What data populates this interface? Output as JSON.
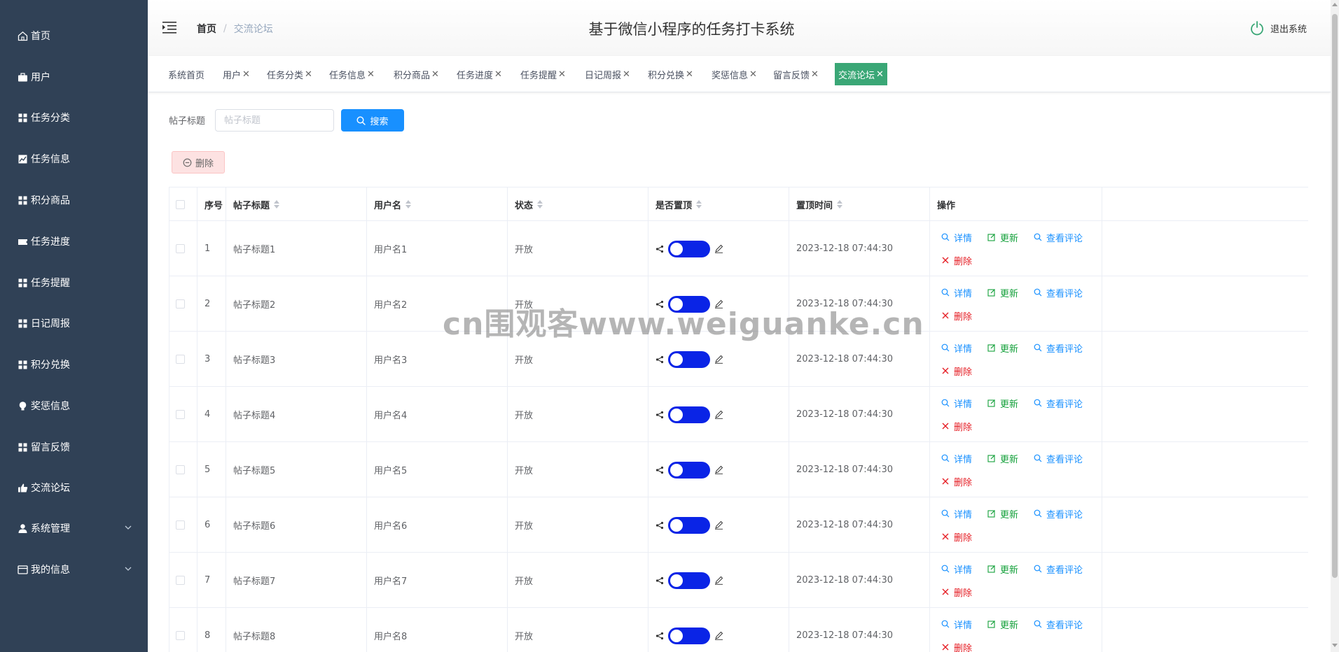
{
  "app": {
    "title": "基于微信小程序的任务打卡系统",
    "logout_label": "退出系统"
  },
  "breadcrumb": {
    "home": "首页",
    "separator": "/",
    "current": "交流论坛"
  },
  "sidebar": {
    "items": [
      {
        "label": "首页",
        "icon": "home-icon"
      },
      {
        "label": "用户",
        "icon": "briefcase-icon"
      },
      {
        "label": "任务分类",
        "icon": "grid-icon"
      },
      {
        "label": "任务信息",
        "icon": "chart-icon"
      },
      {
        "label": "积分商品",
        "icon": "grid-icon"
      },
      {
        "label": "任务进度",
        "icon": "ticket-icon"
      },
      {
        "label": "任务提醒",
        "icon": "grid-icon"
      },
      {
        "label": "日记周报",
        "icon": "grid-icon"
      },
      {
        "label": "积分兑换",
        "icon": "grid-icon"
      },
      {
        "label": "奖惩信息",
        "icon": "bulb-icon"
      },
      {
        "label": "留言反馈",
        "icon": "grid-icon"
      },
      {
        "label": "交流论坛",
        "icon": "thumb-icon"
      },
      {
        "label": "系统管理",
        "icon": "user-icon"
      },
      {
        "label": "我的信息",
        "icon": "card-icon"
      }
    ]
  },
  "tags": [
    {
      "label": "系统首页",
      "closable": false
    },
    {
      "label": "用户",
      "closable": true
    },
    {
      "label": "任务分类",
      "closable": true
    },
    {
      "label": "任务信息",
      "closable": true
    },
    {
      "label": "积分商品",
      "closable": true
    },
    {
      "label": "任务进度",
      "closable": true
    },
    {
      "label": "任务提醒",
      "closable": true
    },
    {
      "label": "日记周报",
      "closable": true
    },
    {
      "label": "积分兑换",
      "closable": true
    },
    {
      "label": "奖惩信息",
      "closable": true
    },
    {
      "label": "留言反馈",
      "closable": true
    },
    {
      "label": "交流论坛",
      "closable": true,
      "active": true
    }
  ],
  "tag_close_glyph": "✕",
  "search": {
    "label": "帖子标题",
    "placeholder": "帖子标题",
    "value": "",
    "button_label": "搜索"
  },
  "delete_button_label": "删除",
  "table": {
    "columns": [
      "序号",
      "帖子标题",
      "用户名",
      "状态",
      "是否置顶",
      "置顶时间",
      "操作"
    ],
    "rows": [
      {
        "index": "1",
        "title": "帖子标题1",
        "username": "用户名1",
        "status": "开放",
        "pinned": true,
        "pin_time": "2023-12-18 07:44:30"
      },
      {
        "index": "2",
        "title": "帖子标题2",
        "username": "用户名2",
        "status": "开放",
        "pinned": true,
        "pin_time": "2023-12-18 07:44:30"
      },
      {
        "index": "3",
        "title": "帖子标题3",
        "username": "用户名3",
        "status": "开放",
        "pinned": true,
        "pin_time": "2023-12-18 07:44:30"
      },
      {
        "index": "4",
        "title": "帖子标题4",
        "username": "用户名4",
        "status": "开放",
        "pinned": true,
        "pin_time": "2023-12-18 07:44:30"
      },
      {
        "index": "5",
        "title": "帖子标题5",
        "username": "用户名5",
        "status": "开放",
        "pinned": true,
        "pin_time": "2023-12-18 07:44:30"
      },
      {
        "index": "6",
        "title": "帖子标题6",
        "username": "用户名6",
        "status": "开放",
        "pinned": true,
        "pin_time": "2023-12-18 07:44:30"
      },
      {
        "index": "7",
        "title": "帖子标题7",
        "username": "用户名7",
        "status": "开放",
        "pinned": true,
        "pin_time": "2023-12-18 07:44:30"
      },
      {
        "index": "8",
        "title": "帖子标题8",
        "username": "用户名8",
        "status": "开放",
        "pinned": true,
        "pin_time": "2023-12-18 07:44:30"
      }
    ],
    "actions": {
      "detail": "详情",
      "update": "更新",
      "view_comments": "查看评论",
      "delete": "删除"
    }
  },
  "watermark": "cn围观客www.weiguanke.cn",
  "colors": {
    "sidebar_bg": "#304156",
    "primary": "#1890ff",
    "active_tag": "#3aa776",
    "switch_on": "#0a24e6",
    "action_green": "#13a03a",
    "action_red": "#e51c23"
  }
}
